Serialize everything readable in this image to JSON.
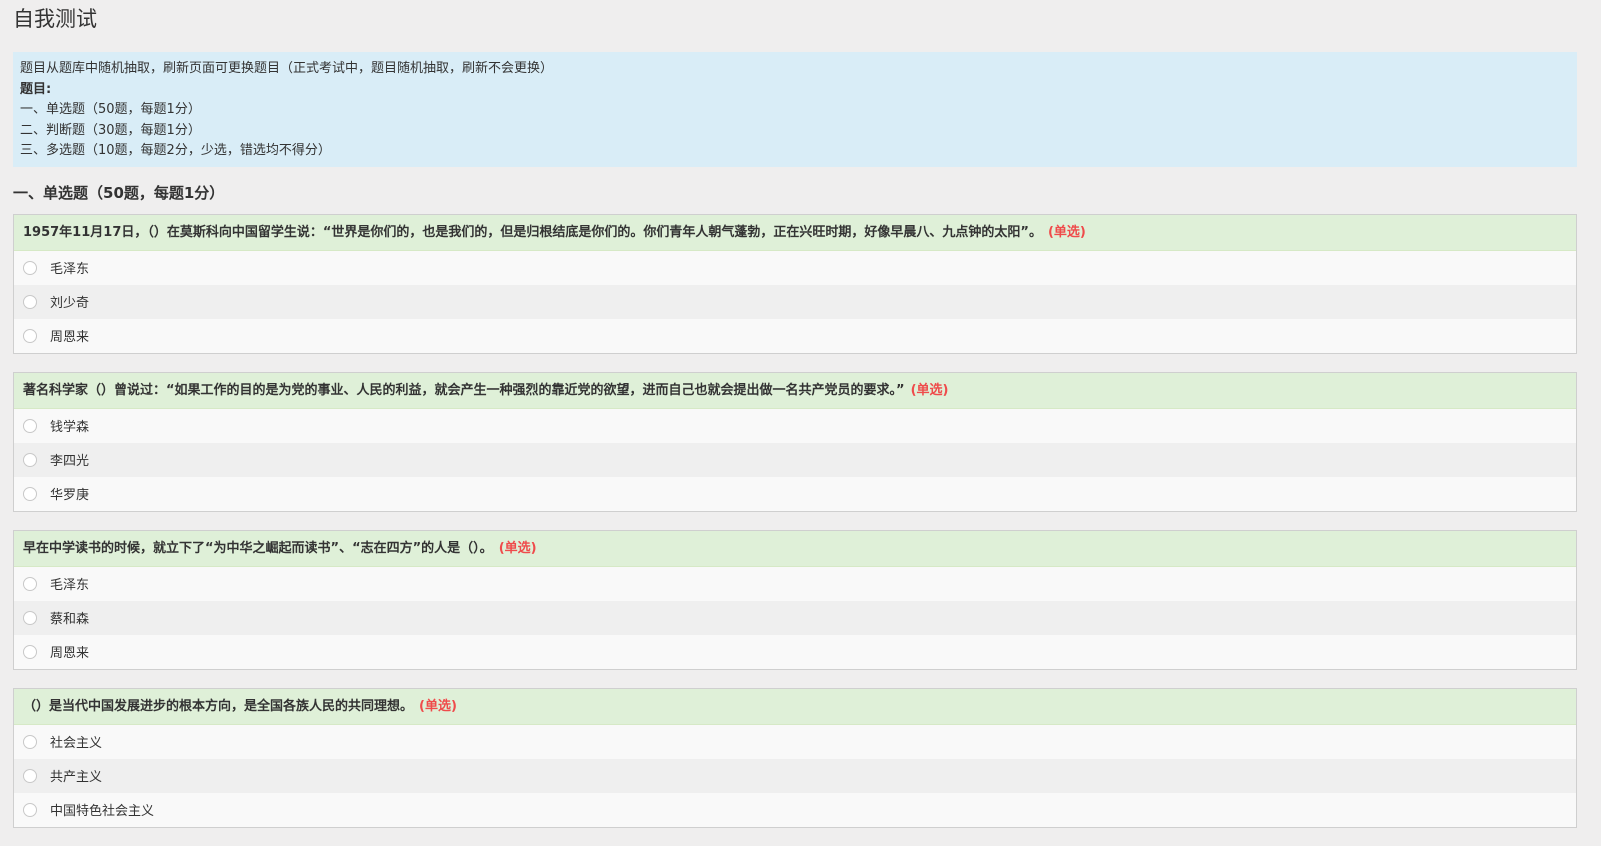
{
  "page": {
    "title": "自我测试"
  },
  "notice": {
    "intro": "题目从题库中随机抽取，刷新页面可更换题目（正式考试中，题目随机抽取，刷新不会更换）",
    "heading": "题目:",
    "lines": [
      "一、单选题（50题，每题1分）",
      "二、判断题（30题，每题1分）",
      "三、多选题（10题，每题2分，少选，错选均不得分）"
    ]
  },
  "section": {
    "title": "一、单选题（50题，每题1分）"
  },
  "questions": [
    {
      "text": "1957年11月17日，（）在莫斯科向中国留学生说：“世界是你们的，也是我们的，但是归根结底是你们的。你们青年人朝气蓬勃，正在兴旺时期，好像早晨八、九点钟的太阳”。",
      "type": "(单选)",
      "options": [
        "毛泽东",
        "刘少奇",
        "周恩来"
      ]
    },
    {
      "text": "著名科学家（）曾说过：“如果工作的目的是为党的事业、人民的利益，就会产生一种强烈的靠近党的欲望，进而自己也就会提出做一名共产党员的要求。”",
      "type": "(单选)",
      "options": [
        "钱学森",
        "李四光",
        "华罗庚"
      ]
    },
    {
      "text": "早在中学读书的时候，就立下了“为中华之崛起而读书”、“志在四方”的人是（）。",
      "type": "(单选)",
      "options": [
        "毛泽东",
        "蔡和森",
        "周恩来"
      ]
    },
    {
      "text": "（）是当代中国发展进步的根本方向，是全国各族人民的共同理想。",
      "type": "(单选)",
      "options": [
        "社会主义",
        "共产主义",
        "中国特色社会主义"
      ]
    }
  ],
  "colors": {
    "page_background": "#efeeee",
    "notice_background": "#d9edf7",
    "question_header_background": "#dff0d8",
    "question_type_color": "#ef4b4b"
  },
  "icons": {
    "option_marker": "radio-icon"
  }
}
